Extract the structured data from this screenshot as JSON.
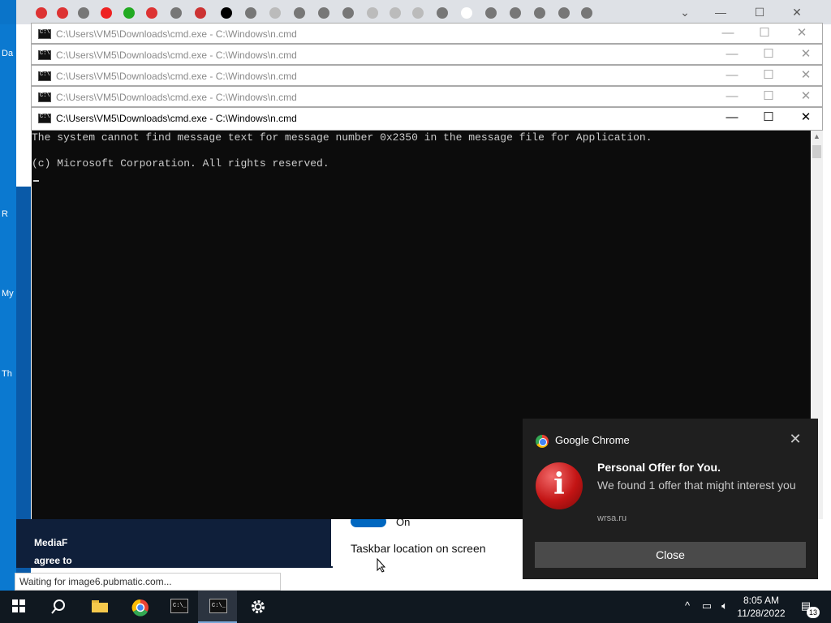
{
  "desktop": {
    "icon_labels": [
      "Da",
      "R",
      "My",
      "Th"
    ]
  },
  "browser": {
    "ad_text_1": "MediaF",
    "ad_text_2": "agree to",
    "status_text": "Waiting for image6.pubmatic.com...",
    "settings_toggle_state": "On",
    "settings_label": "Taskbar location on screen"
  },
  "cmd_windows": [
    {
      "title": "C:\\Users\\VM5\\Downloads\\cmd.exe - C:\\Windows\\n.cmd"
    },
    {
      "title": "C:\\Users\\VM5\\Downloads\\cmd.exe - C:\\Windows\\n.cmd"
    },
    {
      "title": "C:\\Users\\VM5\\Downloads\\cmd.exe - C:\\Windows\\n.cmd"
    },
    {
      "title": "C:\\Users\\VM5\\Downloads\\cmd.exe - C:\\Windows\\n.cmd"
    },
    {
      "title": "C:\\Users\\VM5\\Downloads\\cmd.exe - C:\\Windows\\n.cmd"
    }
  ],
  "console": {
    "line1": "The system cannot find message text for message number 0x2350 in the message file for Application.",
    "line2": "(c) Microsoft Corporation. All rights reserved."
  },
  "window_controls": {
    "minimize": "—",
    "maximize": "☐",
    "close": "✕"
  },
  "toast": {
    "app_name": "Google Chrome",
    "close_x": "✕",
    "icon_glyph": "i",
    "title": "Personal Offer for You.",
    "body": "We found 1 offer that might interest you",
    "source": "wrsa.ru",
    "button_label": "Close"
  },
  "taskbar": {
    "time": "8:05 AM",
    "date": "11/28/2022",
    "notification_count": "13",
    "tray_chevron": "^",
    "accent": "#7aa7d8"
  }
}
